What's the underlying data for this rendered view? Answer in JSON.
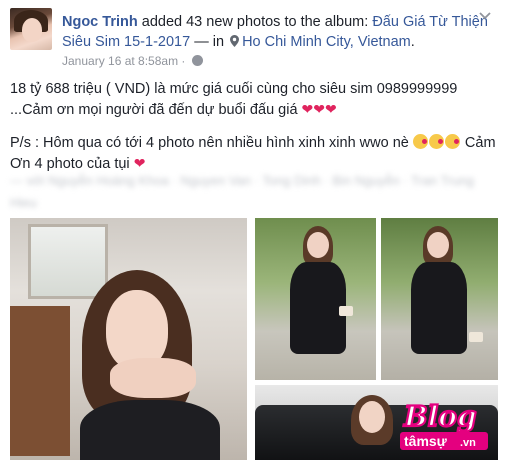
{
  "header": {
    "author": "Ngoc Trinh",
    "action": "added 43 new photos to the album:",
    "album": "Đấu Giá Từ Thiện Siêu Sim 15-1-2017",
    "separator": "— in",
    "location": "Ho Chi Minh City, Vietnam",
    "location_suffix": ".",
    "timestamp": "January 16 at 8:58am",
    "timestamp_sep": "·"
  },
  "post": {
    "line1": "18 tỷ 688 triệu ( VND) là mức giá cuối cùng cho siêu sim 0989999999 ...Cảm ơn mọi người đã đến dự buổi đấu giá",
    "line1_hearts": "❤❤❤",
    "line2": "P/s : Hôm qua có tới 4 photo nên nhiều hình xinh xinh wwo nè",
    "line2_tail": "Cảm Ơn 4 photo của tụi",
    "line2_heart": "❤",
    "tags": "— với Nguyễn Hoàng Khoa · Nguyen Van · Tong Dinh · Bin Nguyễn · Tran Trung Hieu"
  },
  "icons": {
    "pin": "map-pin-icon",
    "globe": "globe-icon",
    "dropdown": "chevron-down-icon"
  },
  "watermark": {
    "brand": "Blog",
    "subtext": "tâmsự",
    "tld": ".vn"
  },
  "colors": {
    "link": "#365899",
    "meta": "#90949c",
    "heart": "#e0245e",
    "watermark": "#e4007f"
  }
}
